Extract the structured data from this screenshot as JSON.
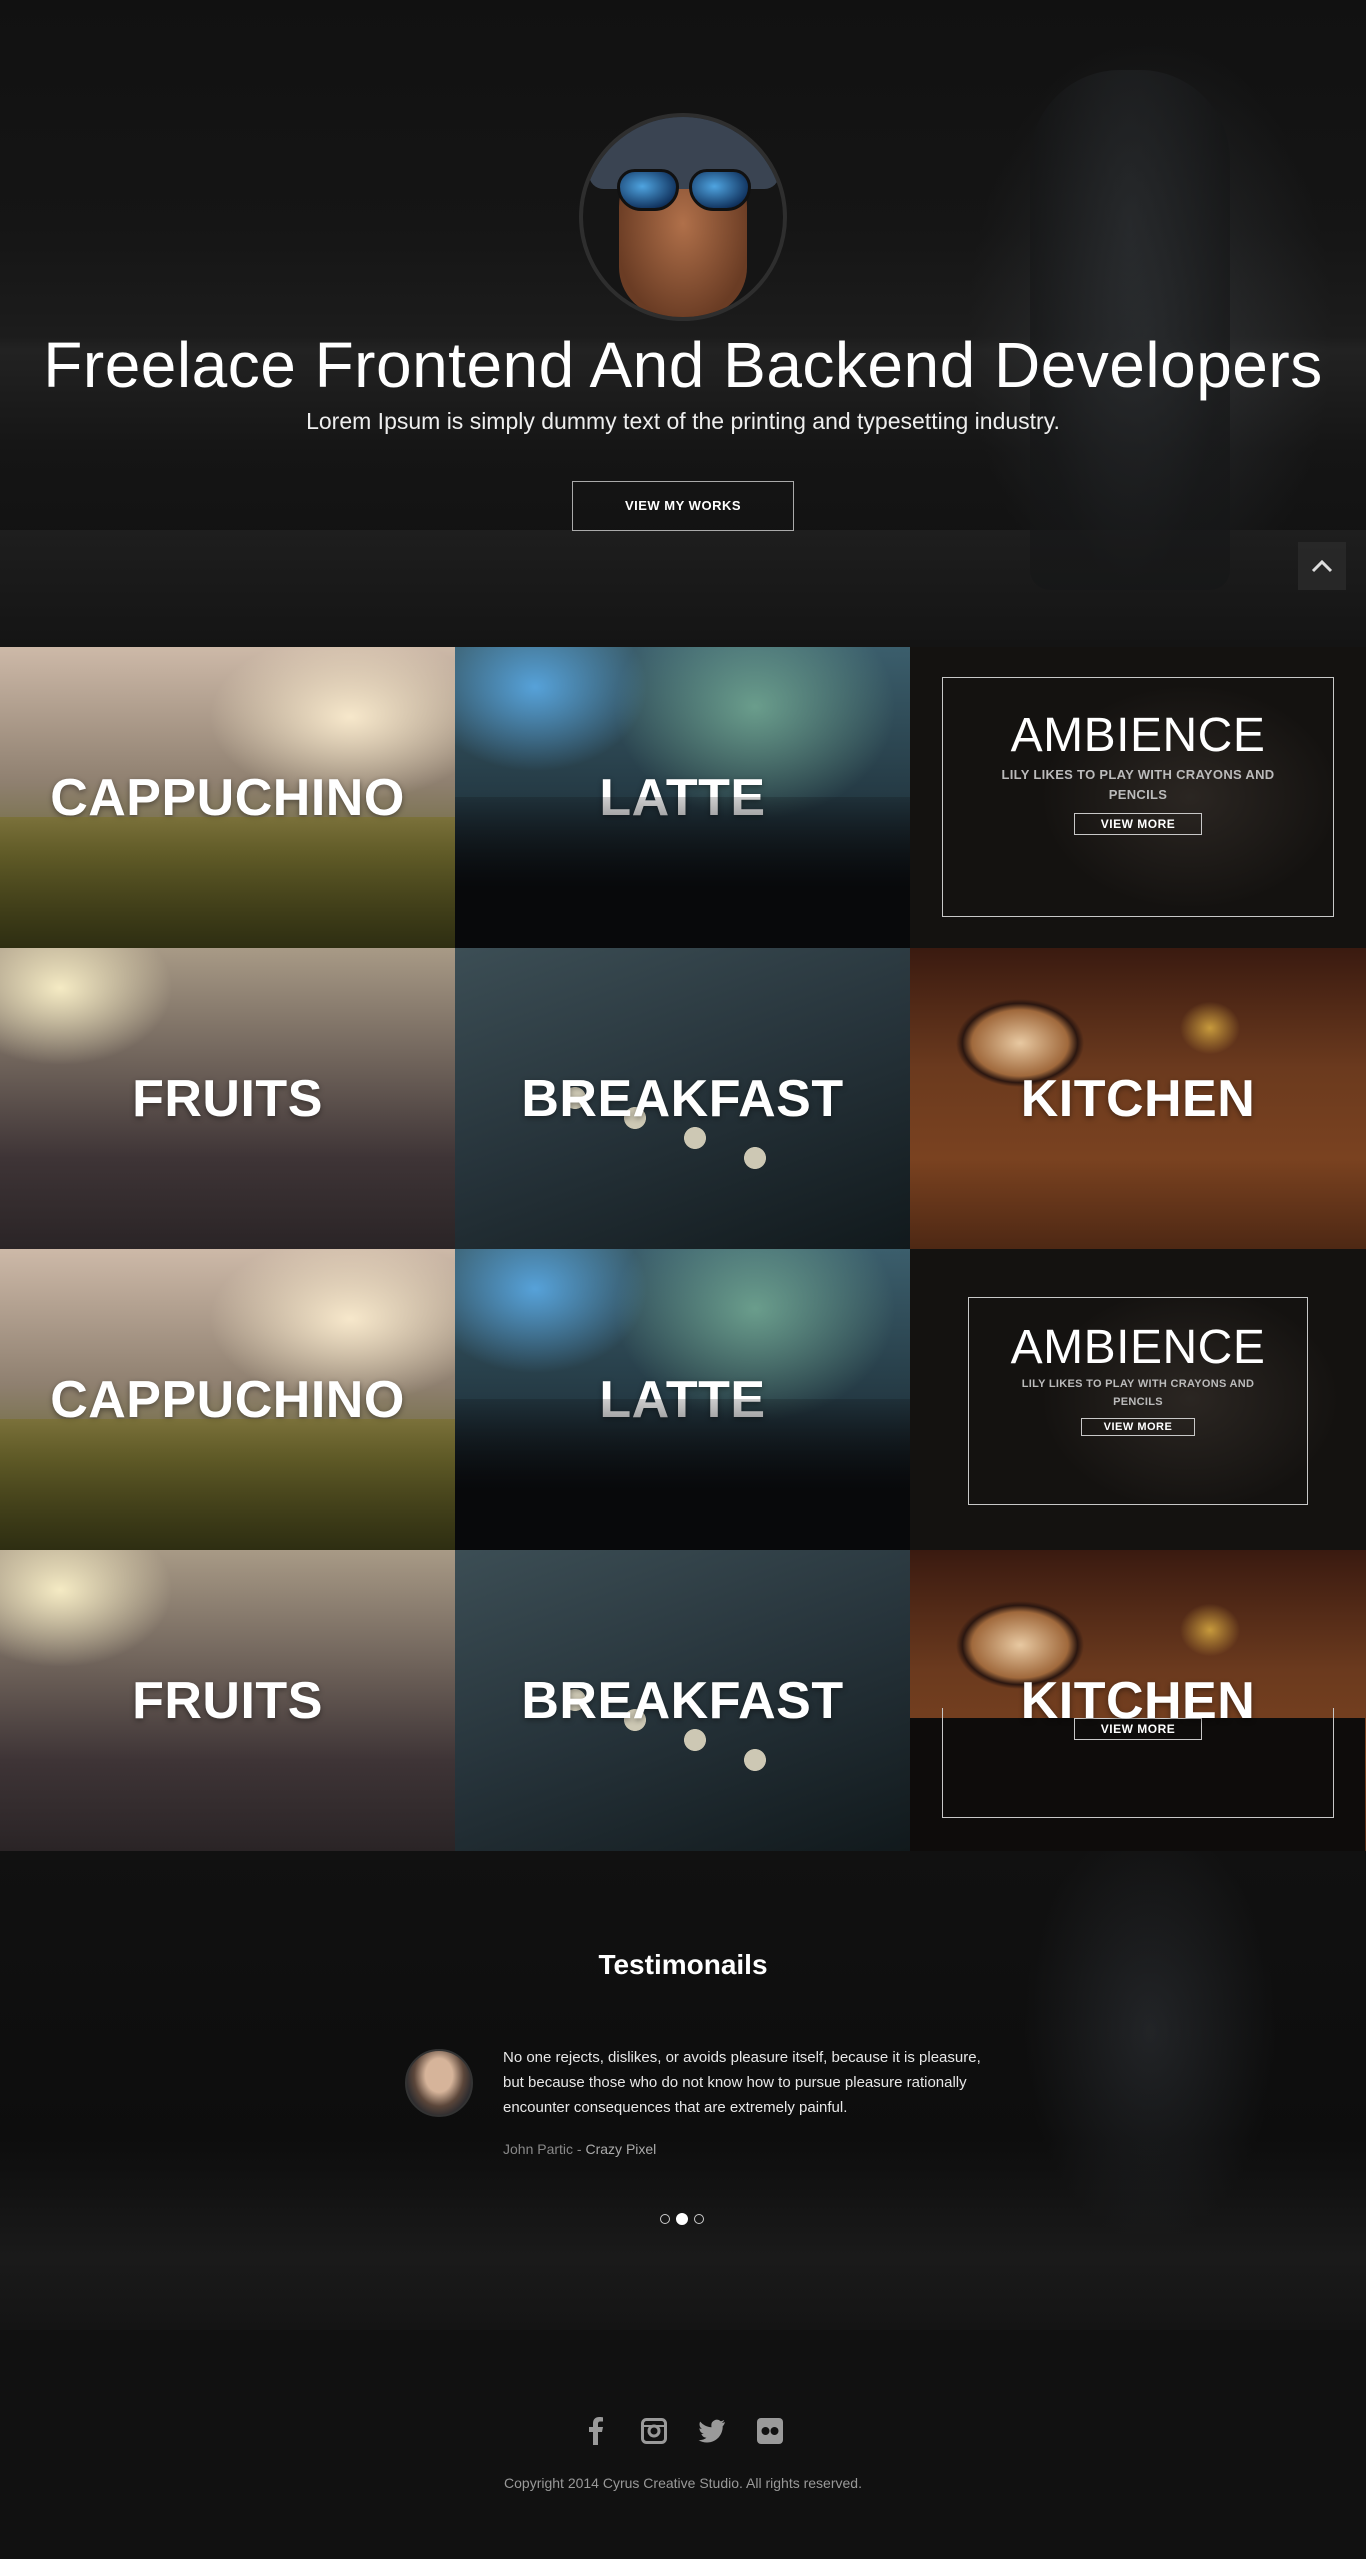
{
  "hero": {
    "title": "Freelace Frontend And Backend Developers",
    "subtitle": "Lorem Ipsum is simply dummy text of the printing and typesetting industry.",
    "button_label": "VIEW MY WORKS"
  },
  "grid": {
    "rows": [
      [
        {
          "label": "CAPPUCHINO"
        },
        {
          "label": "LATTE"
        },
        {
          "label": "AMBIENCE",
          "description": "LILY LIKES TO PLAY WITH CRAYONS AND PENCILS",
          "button": "VIEW MORE"
        }
      ],
      [
        {
          "label": "FRUITS"
        },
        {
          "label": "BREAKFAST"
        },
        {
          "label": "KITCHEN"
        }
      ],
      [
        {
          "label": "CAPPUCHINO"
        },
        {
          "label": "LATTE"
        },
        {
          "label": "AMBIENCE",
          "description": "LILY LIKES TO PLAY WITH CRAYONS AND PENCILS",
          "button": "VIEW MORE"
        }
      ],
      [
        {
          "label": "FRUITS"
        },
        {
          "label": "BREAKFAST"
        },
        {
          "label": "KITCHEN",
          "button": "VIEW MORE"
        }
      ]
    ]
  },
  "testimonials": {
    "title": "Testimonails",
    "quote": "No one rejects, dislikes, or avoids pleasure itself, because it is pleasure, but because those who do not know how to pursue pleasure rationally encounter consequences that are extremely painful.",
    "author": "John Partic",
    "company": "Crazy Pixel",
    "separator": " - ",
    "dots": 3,
    "active_dot": 2
  },
  "footer": {
    "socials": [
      "facebook-icon",
      "instagram-icon",
      "twitter-icon",
      "flickr-icon"
    ],
    "copyright": "Copyright 2014 Cyrus Creative Studio. All rights reserved."
  }
}
